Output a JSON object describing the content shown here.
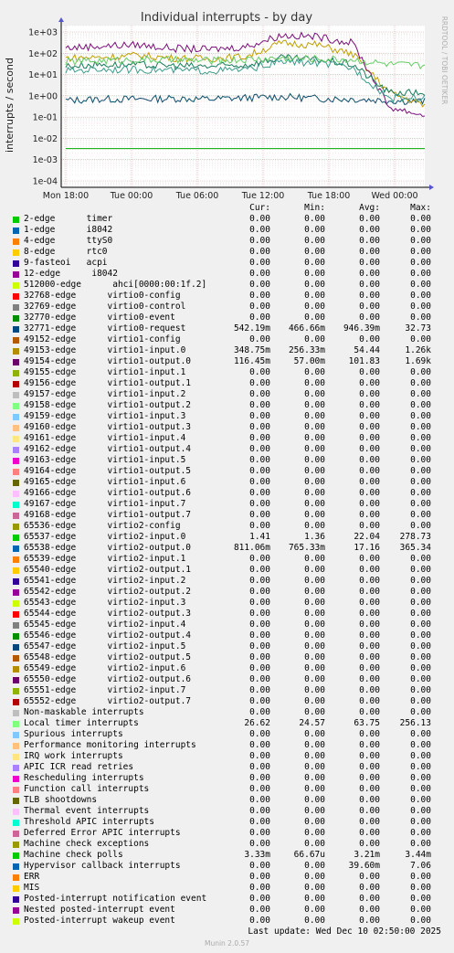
{
  "chart_data": {
    "type": "line",
    "title": "Individual interrupts - by day",
    "ylabel": "interrupts / second",
    "yscale": "log",
    "ylim": [
      5e-05,
      2000
    ],
    "yticks": [
      "1e+03",
      "1e+02",
      "1e+01",
      "1e+00",
      "1e-01",
      "1e-02",
      "1e-03",
      "1e-04"
    ],
    "xticks": [
      "Mon 18:00",
      "Tue 00:00",
      "Tue 06:00",
      "Tue 12:00",
      "Tue 18:00",
      "Wed 00:00"
    ],
    "grid": true,
    "series_approx": [
      {
        "name": "virtio0-request",
        "color": "#0b4f6c",
        "values": [
          0.6,
          0.7,
          0.7,
          0.75,
          0.7,
          0.8,
          0.9,
          0.75,
          0.7,
          0.6,
          0.54
        ]
      },
      {
        "name": "virtio1-input.0",
        "color": "#c0a000",
        "values": [
          60,
          65,
          80,
          60,
          55,
          70,
          300,
          250,
          90,
          1.5,
          0.35
        ]
      },
      {
        "name": "virtio1-output.0",
        "color": "#7a0e7a",
        "values": [
          180,
          220,
          250,
          170,
          150,
          200,
          700,
          600,
          300,
          0.3,
          0.12
        ]
      },
      {
        "name": "virtio2-input.0",
        "color": "#1a7a5a",
        "values": [
          25,
          30,
          28,
          26,
          24,
          28,
          60,
          50,
          30,
          1.4,
          1.4
        ]
      },
      {
        "name": "virtio2-output.0",
        "color": "#3b9b8b",
        "values": [
          15,
          18,
          17,
          16,
          15,
          17,
          40,
          35,
          20,
          0.8,
          0.8
        ]
      },
      {
        "name": "Local timer interrupts",
        "color": "#66cc66",
        "values": [
          40,
          45,
          50,
          48,
          45,
          50,
          60,
          55,
          50,
          30,
          26
        ]
      },
      {
        "name": "Machine check polls",
        "color": "#00aa00",
        "values": [
          0.0033,
          0.0033,
          0.0033,
          0.0033,
          0.0033,
          0.0033,
          0.0033,
          0.0033,
          0.0033,
          0.0033,
          0.0033
        ]
      }
    ]
  },
  "side_text": "RRDTOOL / TOBI OETIKER",
  "legend": {
    "headers": [
      "Cur:",
      "Min:",
      "Avg:",
      "Max:"
    ],
    "rows": [
      {
        "name": "2-edge      timer",
        "color": "#00cc00",
        "cur": "0.00",
        "min": "0.00",
        "avg": "0.00",
        "max": "0.00"
      },
      {
        "name": "1-edge      i8042",
        "color": "#0066b3",
        "cur": "0.00",
        "min": "0.00",
        "avg": "0.00",
        "max": "0.00"
      },
      {
        "name": "4-edge      ttyS0",
        "color": "#ff8000",
        "cur": "0.00",
        "min": "0.00",
        "avg": "0.00",
        "max": "0.00"
      },
      {
        "name": "8-edge      rtc0",
        "color": "#ffcc00",
        "cur": "0.00",
        "min": "0.00",
        "avg": "0.00",
        "max": "0.00"
      },
      {
        "name": "9-fasteoi   acpi",
        "color": "#330099",
        "cur": "0.00",
        "min": "0.00",
        "avg": "0.00",
        "max": "0.00"
      },
      {
        "name": "12-edge      i8042",
        "color": "#990099",
        "cur": "0.00",
        "min": "0.00",
        "avg": "0.00",
        "max": "0.00"
      },
      {
        "name": "512000-edge      ahci[0000:00:1f.2]",
        "color": "#ccff00",
        "cur": "0.00",
        "min": "0.00",
        "avg": "0.00",
        "max": "0.00"
      },
      {
        "name": "32768-edge      virtio0-config",
        "color": "#ff0000",
        "cur": "0.00",
        "min": "0.00",
        "avg": "0.00",
        "max": "0.00"
      },
      {
        "name": "32769-edge      virtio0-control",
        "color": "#808080",
        "cur": "0.00",
        "min": "0.00",
        "avg": "0.00",
        "max": "0.00"
      },
      {
        "name": "32770-edge      virtio0-event",
        "color": "#008f00",
        "cur": "0.00",
        "min": "0.00",
        "avg": "0.00",
        "max": "0.00"
      },
      {
        "name": "32771-edge      virtio0-request",
        "color": "#00487d",
        "cur": "542.19m",
        "min": "466.66m",
        "avg": "946.39m",
        "max": "32.73"
      },
      {
        "name": "49152-edge      virtio1-config",
        "color": "#b35a00",
        "cur": "0.00",
        "min": "0.00",
        "avg": "0.00",
        "max": "0.00"
      },
      {
        "name": "49153-edge      virtio1-input.0",
        "color": "#b38f00",
        "cur": "348.75m",
        "min": "256.33m",
        "avg": "54.44",
        "max": "1.26k"
      },
      {
        "name": "49154-edge      virtio1-output.0",
        "color": "#6b006b",
        "cur": "116.45m",
        "min": "57.00m",
        "avg": "101.83",
        "max": "1.69k"
      },
      {
        "name": "49155-edge      virtio1-input.1",
        "color": "#8fb300",
        "cur": "0.00",
        "min": "0.00",
        "avg": "0.00",
        "max": "0.00"
      },
      {
        "name": "49156-edge      virtio1-output.1",
        "color": "#b30000",
        "cur": "0.00",
        "min": "0.00",
        "avg": "0.00",
        "max": "0.00"
      },
      {
        "name": "49157-edge      virtio1-input.2",
        "color": "#bebebe",
        "cur": "0.00",
        "min": "0.00",
        "avg": "0.00",
        "max": "0.00"
      },
      {
        "name": "49158-edge      virtio1-output.2",
        "color": "#80ff80",
        "cur": "0.00",
        "min": "0.00",
        "avg": "0.00",
        "max": "0.00"
      },
      {
        "name": "49159-edge      virtio1-input.3",
        "color": "#80c9ff",
        "cur": "0.00",
        "min": "0.00",
        "avg": "0.00",
        "max": "0.00"
      },
      {
        "name": "49160-edge      virtio1-output.3",
        "color": "#ffc080",
        "cur": "0.00",
        "min": "0.00",
        "avg": "0.00",
        "max": "0.00"
      },
      {
        "name": "49161-edge      virtio1-input.4",
        "color": "#ffe680",
        "cur": "0.00",
        "min": "0.00",
        "avg": "0.00",
        "max": "0.00"
      },
      {
        "name": "49162-edge      virtio1-output.4",
        "color": "#aa80ff",
        "cur": "0.00",
        "min": "0.00",
        "avg": "0.00",
        "max": "0.00"
      },
      {
        "name": "49163-edge      virtio1-input.5",
        "color": "#ee00cc",
        "cur": "0.00",
        "min": "0.00",
        "avg": "0.00",
        "max": "0.00"
      },
      {
        "name": "49164-edge      virtio1-output.5",
        "color": "#ff8080",
        "cur": "0.00",
        "min": "0.00",
        "avg": "0.00",
        "max": "0.00"
      },
      {
        "name": "49165-edge      virtio1-input.6",
        "color": "#666600",
        "cur": "0.00",
        "min": "0.00",
        "avg": "0.00",
        "max": "0.00"
      },
      {
        "name": "49166-edge      virtio1-output.6",
        "color": "#ffbfff",
        "cur": "0.00",
        "min": "0.00",
        "avg": "0.00",
        "max": "0.00"
      },
      {
        "name": "49167-edge      virtio1-input.7",
        "color": "#00ffcc",
        "cur": "0.00",
        "min": "0.00",
        "avg": "0.00",
        "max": "0.00"
      },
      {
        "name": "49168-edge      virtio1-output.7",
        "color": "#cc6699",
        "cur": "0.00",
        "min": "0.00",
        "avg": "0.00",
        "max": "0.00"
      },
      {
        "name": "65536-edge      virtio2-config",
        "color": "#999900",
        "cur": "0.00",
        "min": "0.00",
        "avg": "0.00",
        "max": "0.00"
      },
      {
        "name": "65537-edge      virtio2-input.0",
        "color": "#00cc00",
        "cur": "1.41",
        "min": "1.36",
        "avg": "22.04",
        "max": "278.73"
      },
      {
        "name": "65538-edge      virtio2-output.0",
        "color": "#0066b3",
        "cur": "811.06m",
        "min": "765.33m",
        "avg": "17.16",
        "max": "365.34"
      },
      {
        "name": "65539-edge      virtio2-input.1",
        "color": "#ff8000",
        "cur": "0.00",
        "min": "0.00",
        "avg": "0.00",
        "max": "0.00"
      },
      {
        "name": "65540-edge      virtio2-output.1",
        "color": "#ffcc00",
        "cur": "0.00",
        "min": "0.00",
        "avg": "0.00",
        "max": "0.00"
      },
      {
        "name": "65541-edge      virtio2-input.2",
        "color": "#330099",
        "cur": "0.00",
        "min": "0.00",
        "avg": "0.00",
        "max": "0.00"
      },
      {
        "name": "65542-edge      virtio2-output.2",
        "color": "#990099",
        "cur": "0.00",
        "min": "0.00",
        "avg": "0.00",
        "max": "0.00"
      },
      {
        "name": "65543-edge      virtio2-input.3",
        "color": "#ccff00",
        "cur": "0.00",
        "min": "0.00",
        "avg": "0.00",
        "max": "0.00"
      },
      {
        "name": "65544-edge      virtio2-output.3",
        "color": "#ff0000",
        "cur": "0.00",
        "min": "0.00",
        "avg": "0.00",
        "max": "0.00"
      },
      {
        "name": "65545-edge      virtio2-input.4",
        "color": "#808080",
        "cur": "0.00",
        "min": "0.00",
        "avg": "0.00",
        "max": "0.00"
      },
      {
        "name": "65546-edge      virtio2-output.4",
        "color": "#008f00",
        "cur": "0.00",
        "min": "0.00",
        "avg": "0.00",
        "max": "0.00"
      },
      {
        "name": "65547-edge      virtio2-input.5",
        "color": "#00487d",
        "cur": "0.00",
        "min": "0.00",
        "avg": "0.00",
        "max": "0.00"
      },
      {
        "name": "65548-edge      virtio2-output.5",
        "color": "#b35a00",
        "cur": "0.00",
        "min": "0.00",
        "avg": "0.00",
        "max": "0.00"
      },
      {
        "name": "65549-edge      virtio2-input.6",
        "color": "#b38f00",
        "cur": "0.00",
        "min": "0.00",
        "avg": "0.00",
        "max": "0.00"
      },
      {
        "name": "65550-edge      virtio2-output.6",
        "color": "#6b006b",
        "cur": "0.00",
        "min": "0.00",
        "avg": "0.00",
        "max": "0.00"
      },
      {
        "name": "65551-edge      virtio2-input.7",
        "color": "#8fb300",
        "cur": "0.00",
        "min": "0.00",
        "avg": "0.00",
        "max": "0.00"
      },
      {
        "name": "65552-edge      virtio2-output.7",
        "color": "#b30000",
        "cur": "0.00",
        "min": "0.00",
        "avg": "0.00",
        "max": "0.00"
      },
      {
        "name": "Non-maskable interrupts",
        "color": "#bebebe",
        "cur": "0.00",
        "min": "0.00",
        "avg": "0.00",
        "max": "0.00"
      },
      {
        "name": "Local timer interrupts",
        "color": "#80ff80",
        "cur": "26.62",
        "min": "24.57",
        "avg": "63.75",
        "max": "256.13"
      },
      {
        "name": "Spurious interrupts",
        "color": "#80c9ff",
        "cur": "0.00",
        "min": "0.00",
        "avg": "0.00",
        "max": "0.00"
      },
      {
        "name": "Performance monitoring interrupts",
        "color": "#ffc080",
        "cur": "0.00",
        "min": "0.00",
        "avg": "0.00",
        "max": "0.00"
      },
      {
        "name": "IRQ work interrupts",
        "color": "#ffe680",
        "cur": "0.00",
        "min": "0.00",
        "avg": "0.00",
        "max": "0.00"
      },
      {
        "name": "APIC ICR read retries",
        "color": "#aa80ff",
        "cur": "0.00",
        "min": "0.00",
        "avg": "0.00",
        "max": "0.00"
      },
      {
        "name": "Rescheduling interrupts",
        "color": "#ee00cc",
        "cur": "0.00",
        "min": "0.00",
        "avg": "0.00",
        "max": "0.00"
      },
      {
        "name": "Function call interrupts",
        "color": "#ff8080",
        "cur": "0.00",
        "min": "0.00",
        "avg": "0.00",
        "max": "0.00"
      },
      {
        "name": "TLB shootdowns",
        "color": "#666600",
        "cur": "0.00",
        "min": "0.00",
        "avg": "0.00",
        "max": "0.00"
      },
      {
        "name": "Thermal event interrupts",
        "color": "#ffbfff",
        "cur": "0.00",
        "min": "0.00",
        "avg": "0.00",
        "max": "0.00"
      },
      {
        "name": "Threshold APIC interrupts",
        "color": "#00ffcc",
        "cur": "0.00",
        "min": "0.00",
        "avg": "0.00",
        "max": "0.00"
      },
      {
        "name": "Deferred Error APIC interrupts",
        "color": "#cc6699",
        "cur": "0.00",
        "min": "0.00",
        "avg": "0.00",
        "max": "0.00"
      },
      {
        "name": "Machine check exceptions",
        "color": "#999900",
        "cur": "0.00",
        "min": "0.00",
        "avg": "0.00",
        "max": "0.00"
      },
      {
        "name": "Machine check polls",
        "color": "#00cc00",
        "cur": "3.33m",
        "min": "66.67u",
        "avg": "3.21m",
        "max": "3.44m"
      },
      {
        "name": "Hypervisor callback interrupts",
        "color": "#0066b3",
        "cur": "0.00",
        "min": "0.00",
        "avg": "39.60m",
        "max": "7.06"
      },
      {
        "name": "ERR",
        "color": "#ff8000",
        "cur": "0.00",
        "min": "0.00",
        "avg": "0.00",
        "max": "0.00"
      },
      {
        "name": "MIS",
        "color": "#ffcc00",
        "cur": "0.00",
        "min": "0.00",
        "avg": "0.00",
        "max": "0.00"
      },
      {
        "name": "Posted-interrupt notification event",
        "color": "#330099",
        "cur": "0.00",
        "min": "0.00",
        "avg": "0.00",
        "max": "0.00"
      },
      {
        "name": "Nested posted-interrupt event",
        "color": "#990099",
        "cur": "0.00",
        "min": "0.00",
        "avg": "0.00",
        "max": "0.00"
      },
      {
        "name": "Posted-interrupt wakeup event",
        "color": "#ccff00",
        "cur": "0.00",
        "min": "0.00",
        "avg": "0.00",
        "max": "0.00"
      }
    ]
  },
  "footer": {
    "last_update": "Last update: Wed Dec 10 02:50:00 2025",
    "munin": "Munin 2.0.57"
  }
}
